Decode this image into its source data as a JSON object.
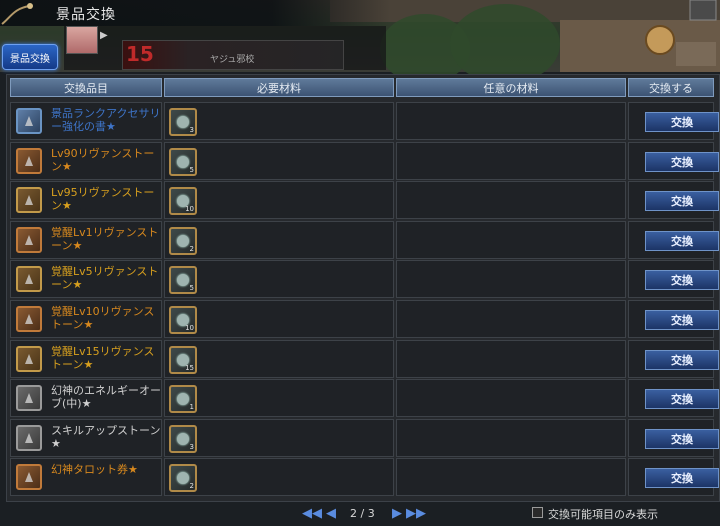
{
  "window": {
    "title": "景品交換"
  },
  "side_tab": {
    "label": "景品交換"
  },
  "hud": {
    "level": "15",
    "text": "ヤジュ邪校"
  },
  "table": {
    "headers": [
      "交換品目",
      "必要材料",
      "任意の材料",
      "交換する"
    ],
    "rows": [
      {
        "name": "景品ランクアクセサリー強化の書★",
        "color": "#3e74c8",
        "icon": "red-scroll-icon",
        "frame": "blue",
        "material_count": "3",
        "button": "交換"
      },
      {
        "name": "Lv90リヴァンストーン★",
        "color": "#d8891e",
        "icon": "rivan-stone-icon",
        "frame": "orange",
        "material_count": "5",
        "button": "交換"
      },
      {
        "name": "Lv95リヴァンストーン★",
        "color": "#d8a01e",
        "icon": "rivan-stone-icon",
        "frame": "gold",
        "material_count": "10",
        "button": "交換"
      },
      {
        "name": "覚醒Lv1リヴァンストーン★",
        "color": "#d8891e",
        "icon": "rivan-stone-icon",
        "frame": "orange",
        "material_count": "2",
        "button": "交換"
      },
      {
        "name": "覚醒Lv5リヴァンストーン★",
        "color": "#d8a01e",
        "icon": "rivan-stone-icon",
        "frame": "gold",
        "material_count": "5",
        "button": "交換"
      },
      {
        "name": "覚醒Lv10リヴァンストーン★",
        "color": "#d8891e",
        "icon": "rivan-stone-icon",
        "frame": "orange",
        "material_count": "10",
        "button": "交換"
      },
      {
        "name": "覚醒Lv15リヴァンストーン★",
        "color": "#d8a01e",
        "icon": "rivan-stone-icon",
        "frame": "gold",
        "material_count": "15",
        "button": "交換"
      },
      {
        "name": "幻神のエネルギーオーブ(中)★",
        "color": "#d0d0d0",
        "icon": "energy-orb-icon",
        "frame": "gray",
        "material_count": "1",
        "button": "交換"
      },
      {
        "name": "スキルアップストーン★",
        "color": "#d0d0d0",
        "icon": "skillup-stone-icon",
        "frame": "gray",
        "material_count": "3",
        "button": "交換"
      },
      {
        "name": "幻神タロット券★",
        "color": "#d8891e",
        "icon": "tarot-ticket-icon",
        "frame": "orange",
        "material_count": "2",
        "button": "交換"
      }
    ]
  },
  "pager": {
    "text": "2 / 3"
  },
  "filter": {
    "label": "交換可能項目のみ表示",
    "checked": false
  }
}
